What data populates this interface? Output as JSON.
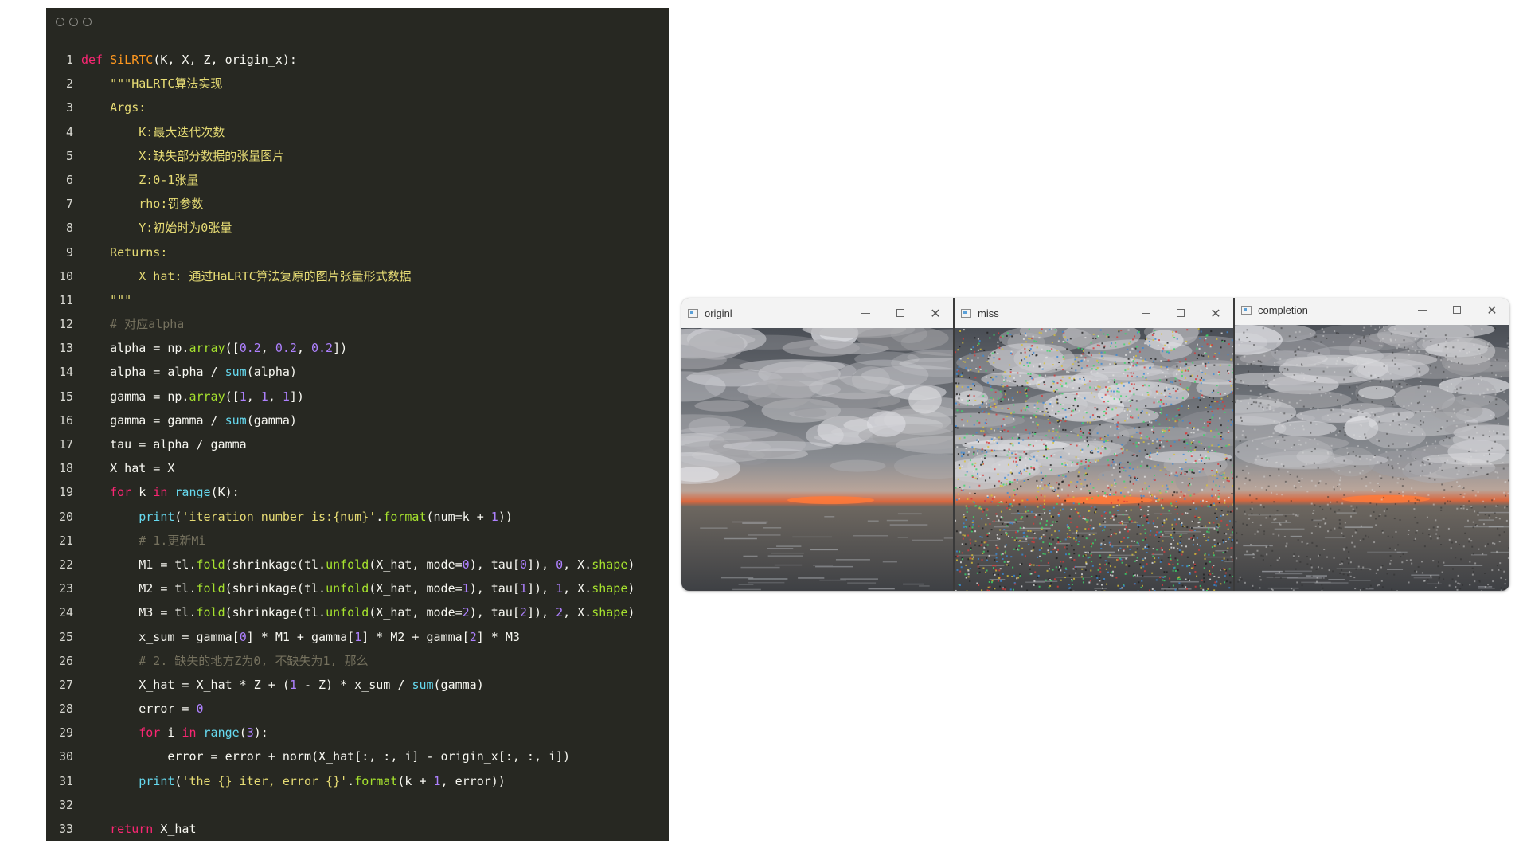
{
  "code_editor": {
    "lines": [
      {
        "num": "1",
        "tokens": [
          {
            "t": "def ",
            "c": "kw"
          },
          {
            "t": "SiLRTC",
            "c": "fn"
          },
          {
            "t": "(K, X, Z, origin_x):",
            "c": "txt"
          }
        ]
      },
      {
        "num": "2",
        "tokens": [
          {
            "t": "    \"\"\"HaLRTC算法实现",
            "c": "str"
          }
        ]
      },
      {
        "num": "3",
        "tokens": [
          {
            "t": "    Args:",
            "c": "str"
          }
        ]
      },
      {
        "num": "4",
        "tokens": [
          {
            "t": "        K:最大迭代次数",
            "c": "str"
          }
        ]
      },
      {
        "num": "5",
        "tokens": [
          {
            "t": "        X:缺失部分数据的张量图片",
            "c": "str"
          }
        ]
      },
      {
        "num": "6",
        "tokens": [
          {
            "t": "        Z:0-1张量",
            "c": "str"
          }
        ]
      },
      {
        "num": "7",
        "tokens": [
          {
            "t": "        rho:罚参数",
            "c": "str"
          }
        ]
      },
      {
        "num": "8",
        "tokens": [
          {
            "t": "        Y:初始时为0张量",
            "c": "str"
          }
        ]
      },
      {
        "num": "9",
        "tokens": [
          {
            "t": "    Returns:",
            "c": "str"
          }
        ]
      },
      {
        "num": "10",
        "tokens": [
          {
            "t": "        X_hat: 通过HaLRTC算法复原的图片张量形式数据",
            "c": "str"
          }
        ]
      },
      {
        "num": "11",
        "tokens": [
          {
            "t": "    \"\"\"",
            "c": "str"
          }
        ]
      },
      {
        "num": "12",
        "tokens": [
          {
            "t": "    # 对应alpha",
            "c": "cm"
          }
        ]
      },
      {
        "num": "13",
        "tokens": [
          {
            "t": "    alpha = np.",
            "c": "txt"
          },
          {
            "t": "array",
            "c": "attr"
          },
          {
            "t": "([",
            "c": "txt"
          },
          {
            "t": "0.2",
            "c": "num"
          },
          {
            "t": ", ",
            "c": "txt"
          },
          {
            "t": "0.2",
            "c": "num"
          },
          {
            "t": ", ",
            "c": "txt"
          },
          {
            "t": "0.2",
            "c": "num"
          },
          {
            "t": "])",
            "c": "txt"
          }
        ]
      },
      {
        "num": "14",
        "tokens": [
          {
            "t": "    alpha = alpha / ",
            "c": "txt"
          },
          {
            "t": "sum",
            "c": "bi"
          },
          {
            "t": "(alpha)",
            "c": "txt"
          }
        ]
      },
      {
        "num": "15",
        "tokens": [
          {
            "t": "    gamma = np.",
            "c": "txt"
          },
          {
            "t": "array",
            "c": "attr"
          },
          {
            "t": "([",
            "c": "txt"
          },
          {
            "t": "1",
            "c": "num"
          },
          {
            "t": ", ",
            "c": "txt"
          },
          {
            "t": "1",
            "c": "num"
          },
          {
            "t": ", ",
            "c": "txt"
          },
          {
            "t": "1",
            "c": "num"
          },
          {
            "t": "])",
            "c": "txt"
          }
        ]
      },
      {
        "num": "16",
        "tokens": [
          {
            "t": "    gamma = gamma / ",
            "c": "txt"
          },
          {
            "t": "sum",
            "c": "bi"
          },
          {
            "t": "(gamma)",
            "c": "txt"
          }
        ]
      },
      {
        "num": "17",
        "tokens": [
          {
            "t": "    tau = alpha / gamma",
            "c": "txt"
          }
        ]
      },
      {
        "num": "18",
        "tokens": [
          {
            "t": "    X_hat = X",
            "c": "txt"
          }
        ]
      },
      {
        "num": "19",
        "tokens": [
          {
            "t": "    ",
            "c": "txt"
          },
          {
            "t": "for",
            "c": "kw"
          },
          {
            "t": " k ",
            "c": "txt"
          },
          {
            "t": "in",
            "c": "kw"
          },
          {
            "t": " ",
            "c": "txt"
          },
          {
            "t": "range",
            "c": "bi"
          },
          {
            "t": "(K):",
            "c": "txt"
          }
        ]
      },
      {
        "num": "20",
        "tokens": [
          {
            "t": "        ",
            "c": "txt"
          },
          {
            "t": "print",
            "c": "bi"
          },
          {
            "t": "(",
            "c": "txt"
          },
          {
            "t": "'iteration number is:{num}'",
            "c": "str"
          },
          {
            "t": ".",
            "c": "txt"
          },
          {
            "t": "format",
            "c": "attr"
          },
          {
            "t": "(num=k + ",
            "c": "txt"
          },
          {
            "t": "1",
            "c": "num"
          },
          {
            "t": "))",
            "c": "txt"
          }
        ]
      },
      {
        "num": "21",
        "tokens": [
          {
            "t": "        # 1.更新Mi",
            "c": "cm"
          }
        ]
      },
      {
        "num": "22",
        "tokens": [
          {
            "t": "        M1 = tl.",
            "c": "txt"
          },
          {
            "t": "fold",
            "c": "attr"
          },
          {
            "t": "(shrinkage(tl.",
            "c": "txt"
          },
          {
            "t": "unfold",
            "c": "attr"
          },
          {
            "t": "(X_hat, mode=",
            "c": "txt"
          },
          {
            "t": "0",
            "c": "num"
          },
          {
            "t": "), tau[",
            "c": "txt"
          },
          {
            "t": "0",
            "c": "num"
          },
          {
            "t": "]), ",
            "c": "txt"
          },
          {
            "t": "0",
            "c": "num"
          },
          {
            "t": ", X.",
            "c": "txt"
          },
          {
            "t": "shape",
            "c": "attr"
          },
          {
            "t": ")",
            "c": "txt"
          }
        ]
      },
      {
        "num": "23",
        "tokens": [
          {
            "t": "        M2 = tl.",
            "c": "txt"
          },
          {
            "t": "fold",
            "c": "attr"
          },
          {
            "t": "(shrinkage(tl.",
            "c": "txt"
          },
          {
            "t": "unfold",
            "c": "attr"
          },
          {
            "t": "(X_hat, mode=",
            "c": "txt"
          },
          {
            "t": "1",
            "c": "num"
          },
          {
            "t": "), tau[",
            "c": "txt"
          },
          {
            "t": "1",
            "c": "num"
          },
          {
            "t": "]), ",
            "c": "txt"
          },
          {
            "t": "1",
            "c": "num"
          },
          {
            "t": ", X.",
            "c": "txt"
          },
          {
            "t": "shape",
            "c": "attr"
          },
          {
            "t": ")",
            "c": "txt"
          }
        ]
      },
      {
        "num": "24",
        "tokens": [
          {
            "t": "        M3 = tl.",
            "c": "txt"
          },
          {
            "t": "fold",
            "c": "attr"
          },
          {
            "t": "(shrinkage(tl.",
            "c": "txt"
          },
          {
            "t": "unfold",
            "c": "attr"
          },
          {
            "t": "(X_hat, mode=",
            "c": "txt"
          },
          {
            "t": "2",
            "c": "num"
          },
          {
            "t": "), tau[",
            "c": "txt"
          },
          {
            "t": "2",
            "c": "num"
          },
          {
            "t": "]), ",
            "c": "txt"
          },
          {
            "t": "2",
            "c": "num"
          },
          {
            "t": ", X.",
            "c": "txt"
          },
          {
            "t": "shape",
            "c": "attr"
          },
          {
            "t": ")",
            "c": "txt"
          }
        ]
      },
      {
        "num": "25",
        "tokens": [
          {
            "t": "        x_sum = gamma[",
            "c": "txt"
          },
          {
            "t": "0",
            "c": "num"
          },
          {
            "t": "] * M1 + gamma[",
            "c": "txt"
          },
          {
            "t": "1",
            "c": "num"
          },
          {
            "t": "] * M2 + gamma[",
            "c": "txt"
          },
          {
            "t": "2",
            "c": "num"
          },
          {
            "t": "] * M3",
            "c": "txt"
          }
        ]
      },
      {
        "num": "26",
        "tokens": [
          {
            "t": "        # 2. 缺失的地方Z为0, 不缺失为1, 那么",
            "c": "cm"
          }
        ]
      },
      {
        "num": "27",
        "tokens": [
          {
            "t": "        X_hat = X_hat * Z + (",
            "c": "txt"
          },
          {
            "t": "1",
            "c": "num"
          },
          {
            "t": " - Z) * x_sum / ",
            "c": "txt"
          },
          {
            "t": "sum",
            "c": "bi"
          },
          {
            "t": "(gamma)",
            "c": "txt"
          }
        ]
      },
      {
        "num": "28",
        "tokens": [
          {
            "t": "        error = ",
            "c": "txt"
          },
          {
            "t": "0",
            "c": "num"
          }
        ]
      },
      {
        "num": "29",
        "tokens": [
          {
            "t": "        ",
            "c": "txt"
          },
          {
            "t": "for",
            "c": "kw"
          },
          {
            "t": " i ",
            "c": "txt"
          },
          {
            "t": "in",
            "c": "kw"
          },
          {
            "t": " ",
            "c": "txt"
          },
          {
            "t": "range",
            "c": "bi"
          },
          {
            "t": "(",
            "c": "txt"
          },
          {
            "t": "3",
            "c": "num"
          },
          {
            "t": "):",
            "c": "txt"
          }
        ]
      },
      {
        "num": "30",
        "tokens": [
          {
            "t": "            error = error + norm(X_hat[:, :, i] - origin_x[:, :, i])",
            "c": "txt"
          }
        ]
      },
      {
        "num": "31",
        "tokens": [
          {
            "t": "        ",
            "c": "txt"
          },
          {
            "t": "print",
            "c": "bi"
          },
          {
            "t": "(",
            "c": "txt"
          },
          {
            "t": "'the {} iter, error {}'",
            "c": "str"
          },
          {
            "t": ".",
            "c": "txt"
          },
          {
            "t": "format",
            "c": "attr"
          },
          {
            "t": "(k + ",
            "c": "txt"
          },
          {
            "t": "1",
            "c": "num"
          },
          {
            "t": ", error))",
            "c": "txt"
          }
        ]
      },
      {
        "num": "32",
        "tokens": []
      },
      {
        "num": "33",
        "tokens": [
          {
            "t": "    ",
            "c": "txt"
          },
          {
            "t": "return",
            "c": "kw"
          },
          {
            "t": " X_hat",
            "c": "txt"
          }
        ]
      }
    ]
  },
  "image_windows": [
    {
      "title": "originl",
      "image": "original",
      "controls": [
        "minimize-icon",
        "maximize-icon",
        "close-icon"
      ]
    },
    {
      "title": "miss",
      "image": "miss",
      "controls": [
        "minimize-icon",
        "maximize-icon",
        "close-icon"
      ]
    },
    {
      "title": "completion",
      "image": "completion",
      "controls": [
        "minimize-icon",
        "maximize-icon",
        "close-icon"
      ]
    }
  ],
  "colors": {
    "editor_bg": "#272822",
    "keyword": "#f92672",
    "function": "#fd971f",
    "string": "#e6db74",
    "number": "#ae81ff",
    "builtin": "#66d9ef",
    "attribute": "#a6e22e",
    "comment": "#75715e",
    "text": "#f8f8f2"
  }
}
